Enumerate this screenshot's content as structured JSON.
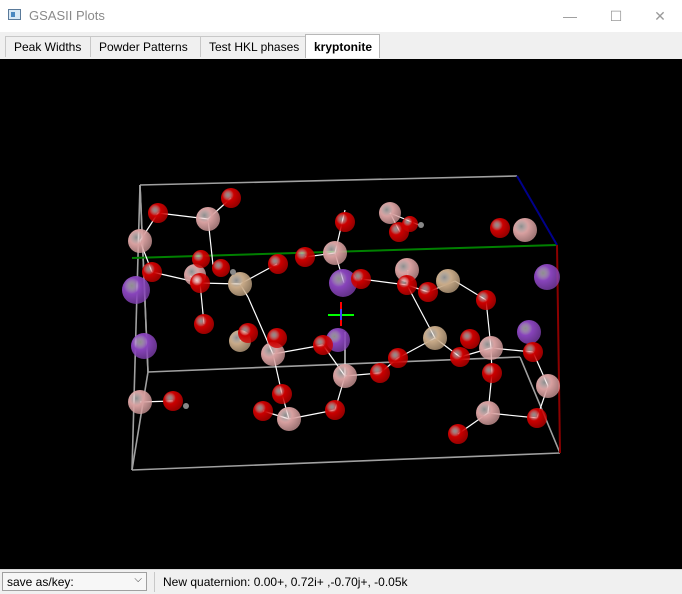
{
  "window": {
    "title": "GSASII Plots",
    "minimize_glyph": "—",
    "maximize_glyph": "☐",
    "close_glyph": "✕"
  },
  "tabs": [
    {
      "label": "Peak Widths"
    },
    {
      "label": "Powder Patterns"
    },
    {
      "label": "Test HKL phases"
    },
    {
      "label": "kryptonite",
      "active": true
    }
  ],
  "status": {
    "select_value": "save as/key:",
    "message": "New quaternion: 0.00+, 0.72i+ ,-0.70j+, -0.05k"
  },
  "scene": {
    "background": "#000000",
    "cell_edge_color": "#a0a0a0",
    "axis_a_color": "#008000",
    "axis_b_color": "#00008b",
    "axis_c_color": "#8b0000",
    "bond_color": "#ffffff",
    "atom_colors": {
      "oxygen": "#cc0000",
      "pink": "#d8a0a0",
      "tan": "#c8aa88",
      "purple": "#8844bb",
      "grey": "#888888"
    }
  }
}
